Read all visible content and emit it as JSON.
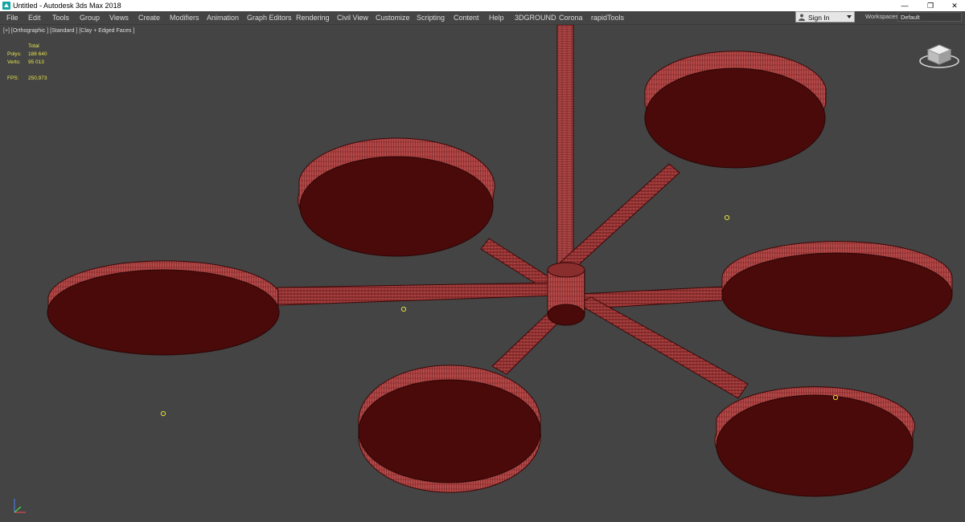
{
  "window": {
    "title": "Untitled - Autodesk 3ds Max 2018",
    "minimize_glyph": "—",
    "maximize_glyph": "❐",
    "close_glyph": "✕"
  },
  "menu": {
    "items": [
      "File",
      "Edit",
      "Tools",
      "Group",
      "Views",
      "Create",
      "Modifiers",
      "Animation",
      "Graph Editors",
      "Rendering",
      "Civil View",
      "Customize",
      "Scripting",
      "Content",
      "Help",
      "3DGROUND",
      "Corona",
      "rapidTools"
    ]
  },
  "account": {
    "sign_in_label": "Sign In"
  },
  "workspaces": {
    "label": "Workspaces:",
    "value": "Default"
  },
  "viewport": {
    "label": "[+] [Orthographic ] [Standard ] [Clay + Edged Faces ]",
    "stats": {
      "header": "Total",
      "polys_label": "Polys:",
      "polys_value": "188 640",
      "verts_label": "Verts:",
      "verts_value": "95 013",
      "fps_label": "FPS:",
      "fps_value": "250,973"
    }
  },
  "icons": {
    "app": "3ds-max-logo-icon",
    "user": "user-icon",
    "viewcube": "viewcube-icon",
    "axis": "axis-tripod-icon"
  },
  "colors": {
    "viewport_bg": "#444444",
    "model_face": "#4a0a0a",
    "model_side": "#b04545",
    "wire": "#2a0505",
    "stats_text": "#e8e44a"
  }
}
